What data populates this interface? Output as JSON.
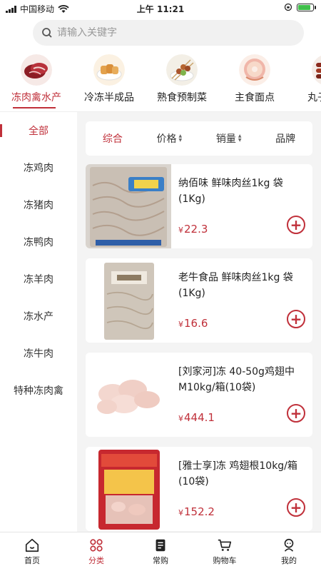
{
  "status": {
    "carrier": "中国移动",
    "time": "上午 11:21",
    "battery_level": 0.75
  },
  "search": {
    "placeholder": "请输入关键字"
  },
  "categories": [
    {
      "label": "冻肉禽水产",
      "icon": "raw-meat-icon",
      "active": true
    },
    {
      "label": "冷冻半成品",
      "icon": "fried-food-icon"
    },
    {
      "label": "熟食预制菜",
      "icon": "skewers-icon"
    },
    {
      "label": "主食面点",
      "icon": "donut-icon"
    },
    {
      "label": "丸子肠串",
      "icon": "sausage-skewer-icon"
    }
  ],
  "sidebar": {
    "items": [
      {
        "label": "全部",
        "active": true
      },
      {
        "label": "冻鸡肉"
      },
      {
        "label": "冻猪肉"
      },
      {
        "label": "冻鸭肉"
      },
      {
        "label": "冻羊肉"
      },
      {
        "label": "冻水产"
      },
      {
        "label": "冻牛肉"
      },
      {
        "label": "特种冻肉禽"
      }
    ]
  },
  "sort": {
    "comprehensive": "综合",
    "price": "价格",
    "sales": "销量",
    "brand": "品牌"
  },
  "products": [
    {
      "name": "纳佰味 鲜味肉丝1kg 袋(1Kg)",
      "currency": "¥",
      "price": "22.3"
    },
    {
      "name": "老牛食品 鲜味肉丝1kg 袋(1Kg)",
      "currency": "¥",
      "price": "16.6"
    },
    {
      "name": "[刘家河]冻 40-50g鸡翅中M10kg/箱(10袋)",
      "currency": "¥",
      "price": "444.1"
    },
    {
      "name": "[雅士享]冻 鸡翅根10kg/箱(10袋)",
      "currency": "¥",
      "price": "152.2"
    }
  ],
  "tabbar": {
    "home": "首页",
    "category": "分类",
    "frequent": "常购",
    "cart": "购物车",
    "mine": "我的"
  },
  "colors": {
    "accent": "#c0303a"
  }
}
